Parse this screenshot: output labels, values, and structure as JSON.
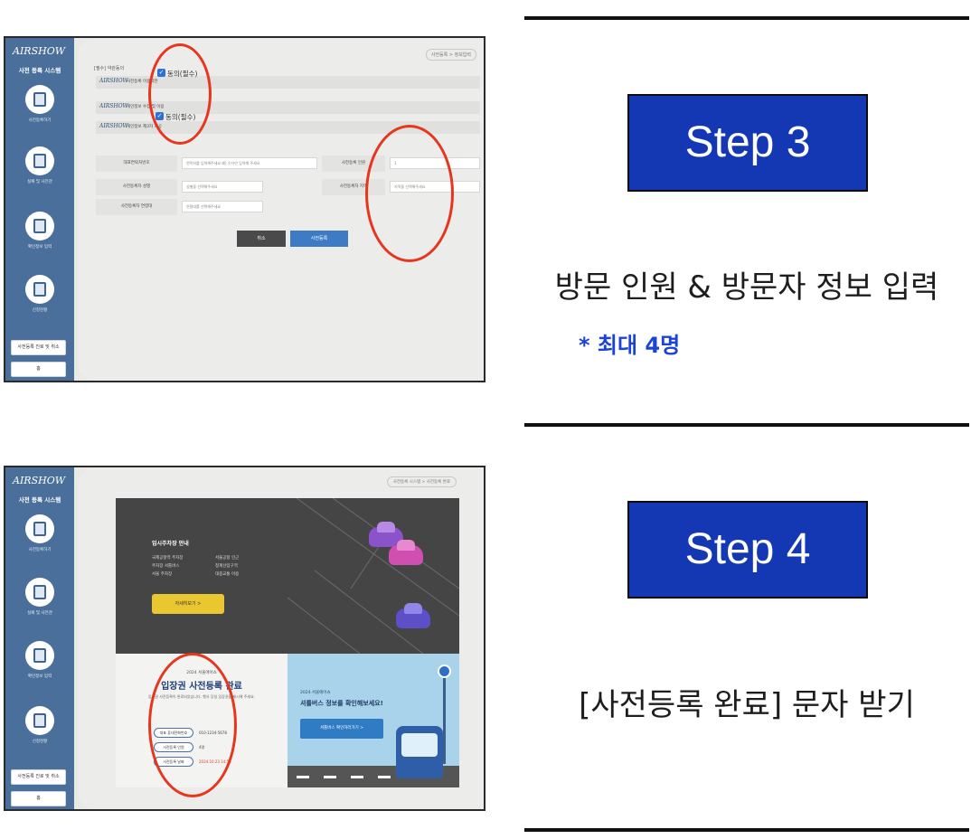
{
  "step3": {
    "badge": "Step 3",
    "description": "방문 인원 & 방문자 정보 입력",
    "note": "* 최대 4명",
    "screenshot": {
      "sidebar": {
        "logo": "AIRSHOW",
        "title": "사전 등록 시스템",
        "menu": [
          "사전등록하기",
          "실패 및 사전관",
          "확인정보 입력",
          "신청현황"
        ],
        "buttons": [
          "사전등록 진로 및 취소",
          "홈"
        ]
      },
      "crumb": "사전등록 > 정보입력",
      "agree_head": "[필수] 약관동의",
      "agree_rows": [
        {
          "logo": "AIRSHOW",
          "text": "사전등록 이용약관",
          "check": "동의(필수)"
        },
        {
          "logo": "AIRSHOW",
          "text": "개인정보 수집 및 이용",
          "check": "동의(필수)"
        },
        {
          "logo": "AIRSHOW",
          "text": "개인정보 제3자 제공",
          "check": ""
        }
      ],
      "form": {
        "rows": [
          {
            "label": "대표연락처번호",
            "placeholder": "연락처를 입력해주세요 예) 숫자만 입력해 주세요",
            "label2": "사전등록 인원",
            "value2": "1"
          },
          {
            "label": "사전등록자 성별",
            "placeholder": "성별을 선택해주세요",
            "label2": "사전등록자 지역",
            "value2": "지역을 선택해주세요"
          },
          {
            "label": "사전등록자 연령대",
            "placeholder": "연령대를 선택해주세요",
            "label2": "",
            "value2": ""
          }
        ],
        "cancel": "취소",
        "submit": "사전등록"
      }
    }
  },
  "step4": {
    "badge": "Step 4",
    "description": "[사전등록 완료] 문자 받기",
    "screenshot": {
      "crumb": "사전등록 시스템 > 사전등록 완료",
      "parking": {
        "title": "임시주차장 안내",
        "items": [
          "국제공항역 주차장",
          "서울공항 인근",
          "주차장 셔틀버스",
          "청계산입구역",
          "서울 주차장",
          "대중교통 이용"
        ],
        "button": "자세히보기 >"
      },
      "done": {
        "small": "2024 서울에어쇼",
        "title": "입장권 사전등록 완료",
        "desc": "입장권 사전등록이 완료되었습니다. 행사 당일 입장권을 제시해 주세요.",
        "fields": [
          {
            "label": "대표 휴대전화번호",
            "value": "010-1234-5678"
          },
          {
            "label": "사전등록 인원",
            "value": "4명"
          },
          {
            "label": "사전등록 날짜",
            "value": "2024.10.23 14:56"
          }
        ]
      },
      "bus": {
        "small": "2024 서울에어쇼",
        "title": "셔틀버스 정보를 확인해보세요!",
        "button": "셔틀버스 확인하러가기 >"
      }
    }
  }
}
